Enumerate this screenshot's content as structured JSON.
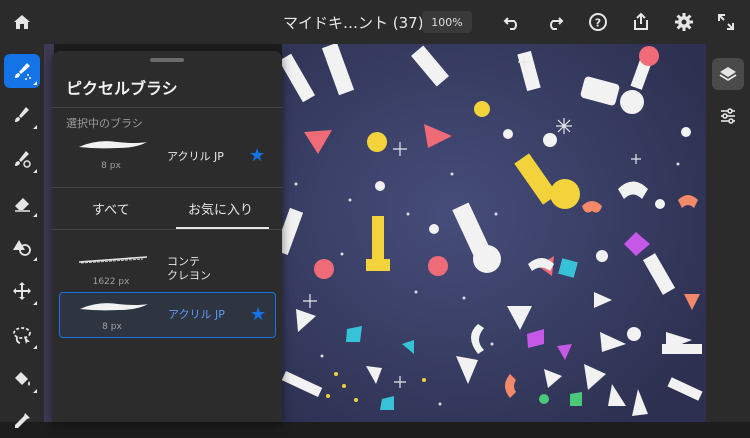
{
  "header": {
    "doc_title": "マイドキ…ント (37)",
    "zoom": "100%"
  },
  "panel": {
    "title": "ピクセルブラシ",
    "selected_label": "選択中のブラシ",
    "selected_brush": {
      "size": "8 px",
      "name": "アクリル JP",
      "favorite": true
    },
    "tabs": [
      {
        "label": "すべて",
        "active": false
      },
      {
        "label": "お気に入り",
        "active": true
      }
    ],
    "favorites": [
      {
        "size": "1622 px",
        "name": "コンテ\nクレヨン",
        "favorite": false,
        "selected": false
      },
      {
        "size": "8 px",
        "name": "アクリル JP",
        "favorite": true,
        "selected": true
      }
    ]
  },
  "colors": {
    "accent": "#1473e6",
    "panel_bg": "#2c2c2c",
    "toolbar_bg": "#2b2b2b",
    "canvas_bg": "#3b3f63"
  },
  "icons": {
    "top": [
      "home-icon",
      "undo-icon",
      "redo-icon",
      "help-icon",
      "share-icon",
      "settings-icon",
      "fullscreen-icon"
    ],
    "left": [
      "brush-icon",
      "eraser-brush-icon",
      "smudge-icon",
      "eraser-icon",
      "shape-icon",
      "move-icon",
      "lasso-icon",
      "fill-icon",
      "eyedropper-icon"
    ],
    "right": [
      "layers-icon",
      "adjustments-icon"
    ]
  }
}
